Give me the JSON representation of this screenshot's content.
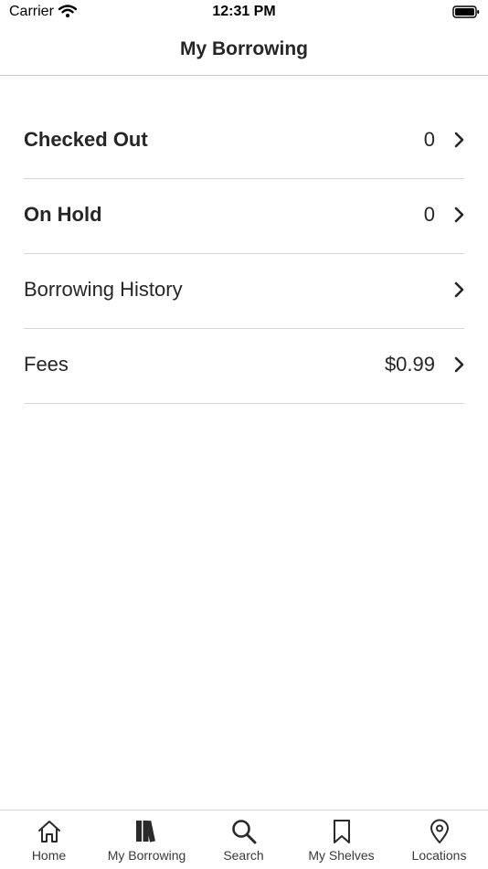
{
  "status_bar": {
    "carrier": "Carrier",
    "time": "12:31 PM"
  },
  "nav": {
    "title": "My Borrowing"
  },
  "rows": [
    {
      "label": "Checked Out",
      "value": "0"
    },
    {
      "label": "On Hold",
      "value": "0"
    },
    {
      "label": "Borrowing History",
      "value": ""
    },
    {
      "label": "Fees",
      "value": "$0.99"
    }
  ],
  "tabs": [
    {
      "label": "Home",
      "icon": "home-icon"
    },
    {
      "label": "My Borrowing",
      "icon": "books-icon"
    },
    {
      "label": "Search",
      "icon": "search-icon"
    },
    {
      "label": "My Shelves",
      "icon": "bookmark-icon"
    },
    {
      "label": "Locations",
      "icon": "location-pin-icon"
    }
  ],
  "colors": {
    "text": "#262626",
    "divider": "#d6d6d6"
  }
}
